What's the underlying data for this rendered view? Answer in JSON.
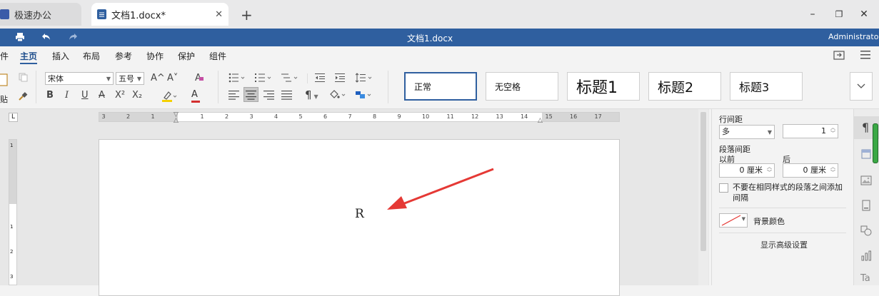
{
  "tabs": [
    {
      "label": "极速办公",
      "icon": "app-logo-icon"
    },
    {
      "label": "文档1.docx*",
      "icon": "document-icon"
    }
  ],
  "new_tab_label": "+",
  "window": {
    "minimize": "–",
    "restore": "❐",
    "close": "✕"
  },
  "titlebar": {
    "doc_title": "文档1.docx",
    "user": "Administrator"
  },
  "menu": [
    "件",
    "主页",
    "插入",
    "布局",
    "参考",
    "协作",
    "保护",
    "组件"
  ],
  "ribbon": {
    "paste_label": "贴",
    "font_name": "宋体",
    "font_size": "五号",
    "bold": "B",
    "italic": "I",
    "underline": "U",
    "strike": "A",
    "superscript": "X²",
    "subscript": "X₂",
    "grow_font": "A^",
    "shrink_font": "A˅",
    "clear_format": "A",
    "font_color": "A",
    "styles": [
      "正常",
      "无空格",
      "标题1",
      "标题2",
      "标题3"
    ]
  },
  "ruler_numbers": [
    "3",
    "2",
    "1",
    "1",
    "2",
    "3",
    "4",
    "5",
    "6",
    "7",
    "8",
    "9",
    "10",
    "11",
    "12",
    "13",
    "14",
    "15",
    "16",
    "17"
  ],
  "vruler_numbers": [
    "1",
    "1",
    "2",
    "3"
  ],
  "document": {
    "text": "R"
  },
  "panel": {
    "line_spacing_label": "行间距",
    "line_spacing_mode": "多",
    "line_spacing_value": "1",
    "para_spacing_label": "段落间距",
    "before_label": "以前",
    "after_label": "后",
    "before_value": "0 厘米",
    "after_value": "0 厘米",
    "no_space_checkbox_label": "不要在相同样式的段落之间添加间隔",
    "bg_color_label": "背景颜色",
    "advanced_link": "显示高级设置"
  },
  "colors": {
    "titlebar": "#2f5f9f",
    "accent_blue": "#2f5f9f",
    "arrow_red": "#e53935",
    "highlight_yellow": "#f4d000",
    "font_color_red": "#d32f2f",
    "scroll_green": "#3aa845"
  }
}
